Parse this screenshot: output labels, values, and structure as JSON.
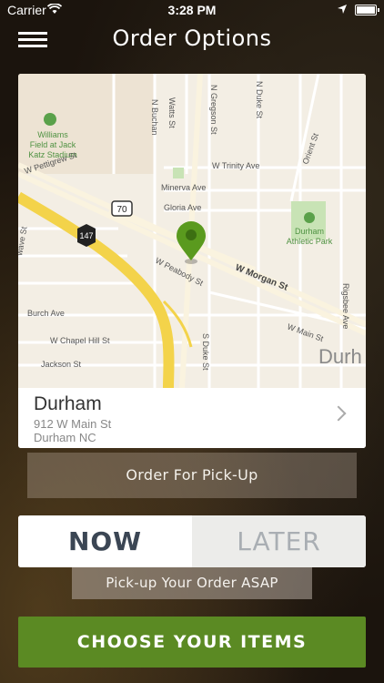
{
  "status_bar": {
    "carrier": "Carrier",
    "time": "3:28 PM"
  },
  "header": {
    "title": "Order Options"
  },
  "map": {
    "labels": {
      "n_buchanan": "N Buchan",
      "watts": "Watts St",
      "n_gregson": "N Gregson St",
      "n_duke": "N Duke St",
      "orient": "Orient St",
      "williams_field": "Williams",
      "williams_field_2": "Field at Jack",
      "williams_field_3": "Katz Stadium",
      "w_pettigrew": "W Pettigrew St",
      "w_trinity": "W Trinity Ave",
      "minerva": "Minerva Ave",
      "gloria": "Gloria Ave",
      "route_70": "70",
      "route_147": "147",
      "durham_athletic": "Durham",
      "durham_athletic_2": "Athletic Park",
      "w_peabody": "W Peabody St",
      "w_morgan": "W Morgan St",
      "burch": "Burch Ave",
      "w_chapel_hill": "W Chapel Hill St",
      "w_main": "W Main St",
      "jackson": "Jackson St",
      "s_duke": "S Duke St",
      "rigsbee": "Rigsbee Ave",
      "city": "Durh",
      "wave": "wave St"
    }
  },
  "location": {
    "name": "Durham",
    "address_line1": "912 W Main St",
    "address_line2": "Durham NC"
  },
  "order_type_label": "Order For Pick-Up",
  "timing": {
    "now_label": "NOW",
    "later_label": "LATER",
    "selected": "NOW"
  },
  "timing_note": "Pick-up Your Order ASAP",
  "cta_label": "CHOOSE YOUR ITEMS",
  "colors": {
    "cta": "#5b8a23",
    "pin": "#5a9a1e",
    "highway": "#f3d34a"
  }
}
